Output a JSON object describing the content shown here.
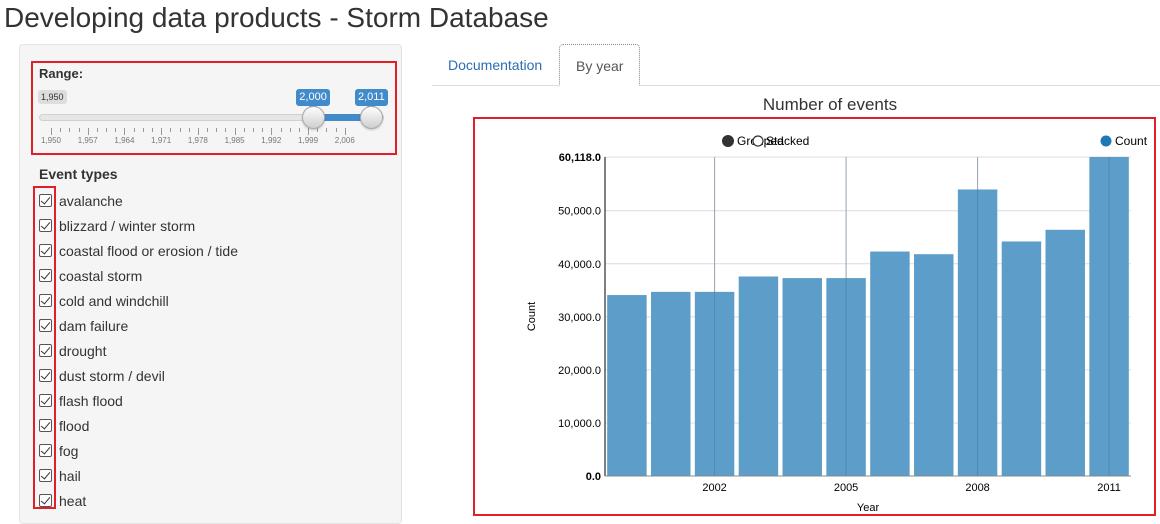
{
  "page": {
    "title": "Developing data products - Storm Database"
  },
  "sidebar": {
    "range": {
      "label": "Range:",
      "min_label": "1,950",
      "from_label": "2,000",
      "to_label": "2,011",
      "min": 1950,
      "max": 2011,
      "from": 2000,
      "to": 2011,
      "grid_labels": [
        "1,950",
        "1,957",
        "1,964",
        "1,971",
        "1,978",
        "1,985",
        "1,992",
        "1,999",
        "2,006"
      ]
    },
    "event_types": {
      "label": "Event types",
      "items": [
        {
          "label": "avalanche",
          "checked": true
        },
        {
          "label": "blizzard / winter storm",
          "checked": true
        },
        {
          "label": "coastal flood or erosion / tide",
          "checked": true
        },
        {
          "label": "coastal storm",
          "checked": true
        },
        {
          "label": "cold and windchill",
          "checked": true
        },
        {
          "label": "dam failure",
          "checked": true
        },
        {
          "label": "drought",
          "checked": true
        },
        {
          "label": "dust storm / devil",
          "checked": true
        },
        {
          "label": "flash flood",
          "checked": true
        },
        {
          "label": "flood",
          "checked": true
        },
        {
          "label": "fog",
          "checked": true
        },
        {
          "label": "hail",
          "checked": true
        },
        {
          "label": "heat",
          "checked": true
        }
      ]
    }
  },
  "tabs": [
    {
      "label": "Documentation",
      "active": false
    },
    {
      "label": "By year",
      "active": true
    }
  ],
  "colors": {
    "bar": "#5a9bc8",
    "link": "#2a6eb0",
    "highlight": "#e01f26",
    "slider": "#428bca"
  },
  "chart_data": {
    "type": "bar",
    "title": "Number of events",
    "xlabel": "Year",
    "ylabel": "Count",
    "controls": [
      "Grouped",
      "Stacked"
    ],
    "series": [
      {
        "name": "Count",
        "x": [
          2000,
          2001,
          2002,
          2003,
          2004,
          2005,
          2006,
          2007,
          2008,
          2009,
          2010,
          2011
        ],
        "values": [
          34100,
          34700,
          34700,
          37600,
          37300,
          37300,
          42300,
          41800,
          54000,
          44200,
          46400,
          60118
        ]
      }
    ],
    "ylim": [
      0,
      60118
    ],
    "y_ticks": [
      "0.0",
      "10,000.0",
      "20,000.0",
      "30,000.0",
      "40,000.0",
      "50,000.0",
      "60,118.0"
    ],
    "x_ticks": [
      "2002",
      "2005",
      "2008",
      "2011"
    ]
  }
}
